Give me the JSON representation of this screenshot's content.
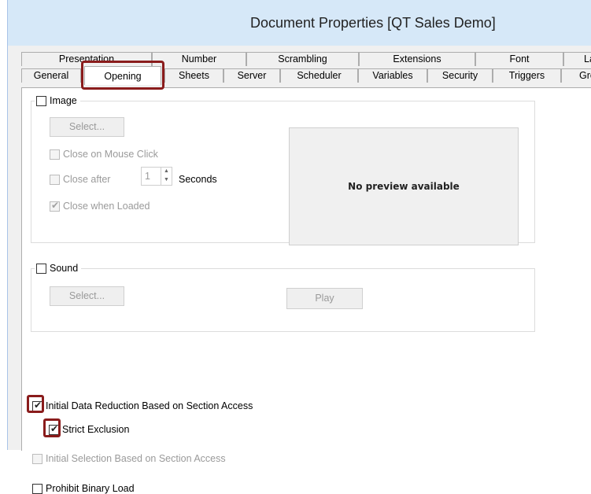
{
  "window": {
    "title": "Document Properties [QT Sales Demo]"
  },
  "tabs_back": [
    {
      "label": "Presentation"
    },
    {
      "label": "Number"
    },
    {
      "label": "Scrambling"
    },
    {
      "label": "Extensions"
    },
    {
      "label": "Font"
    },
    {
      "label": "La"
    }
  ],
  "tabs_front": [
    {
      "label": "General"
    },
    {
      "label": "Opening",
      "active": true
    },
    {
      "label": "Sheets"
    },
    {
      "label": "Server"
    },
    {
      "label": "Scheduler"
    },
    {
      "label": "Variables"
    },
    {
      "label": "Security"
    },
    {
      "label": "Triggers"
    },
    {
      "label": "Gro"
    }
  ],
  "image_group": {
    "legend": "Image",
    "checked": false,
    "select_label": "Select...",
    "close_on_click": {
      "label": "Close on Mouse Click",
      "checked": false
    },
    "close_after": {
      "label": "Close after",
      "checked": false,
      "value": "1",
      "unit": "Seconds"
    },
    "close_when_loaded": {
      "label": "Close when Loaded",
      "checked": true
    },
    "preview_text": "No preview available"
  },
  "sound_group": {
    "legend": "Sound",
    "checked": false,
    "select_label": "Select...",
    "play_label": "Play"
  },
  "options": {
    "initial_data_reduction": {
      "label": "Initial Data Reduction Based on Section Access",
      "checked": true
    },
    "strict_exclusion": {
      "label": "Strict Exclusion",
      "checked": true
    },
    "initial_selection": {
      "label": "Initial Selection Based on Section Access",
      "checked": false
    },
    "prohibit_binary": {
      "label": "Prohibit Binary Load",
      "checked": false
    }
  },
  "colors": {
    "highlight": "#8a1c1c",
    "titlebar": "#d6e8f8"
  }
}
